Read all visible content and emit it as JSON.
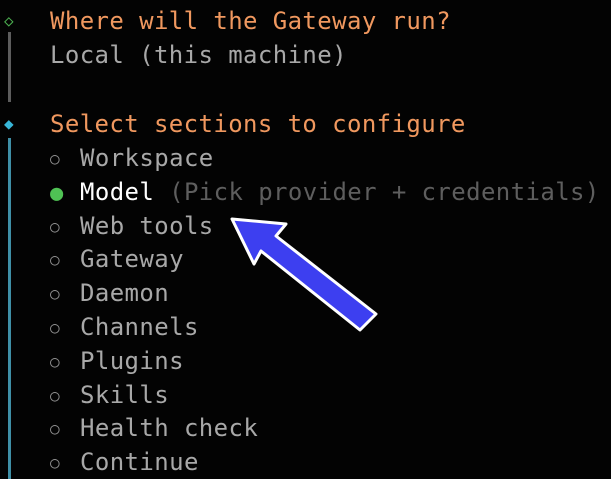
{
  "gateway_question": {
    "prompt": "Where will the Gateway run?",
    "answer": "Local (this machine)"
  },
  "sections_question": {
    "prompt": "Select sections to configure",
    "options": [
      {
        "label": "Workspace",
        "selected": false
      },
      {
        "label": "Model",
        "selected": true,
        "hint": "(Pick provider + credentials)"
      },
      {
        "label": "Web tools",
        "selected": false
      },
      {
        "label": "Gateway",
        "selected": false
      },
      {
        "label": "Daemon",
        "selected": false
      },
      {
        "label": "Channels",
        "selected": false
      },
      {
        "label": "Plugins",
        "selected": false
      },
      {
        "label": "Skills",
        "selected": false
      },
      {
        "label": "Health check",
        "selected": false
      },
      {
        "label": "Continue",
        "selected": false
      }
    ]
  },
  "symbols": {
    "radio_selected": "●",
    "radio_unselected": "○",
    "step_done": "◇",
    "step_active": "◆"
  },
  "colors": {
    "prompt": "#f0985f",
    "selected_radio": "#4fc254",
    "annotation_arrow": "#3d3ff0"
  },
  "icons": [
    "step-done-icon",
    "step-active-icon",
    "radio-icon",
    "annotation-arrow-icon"
  ]
}
